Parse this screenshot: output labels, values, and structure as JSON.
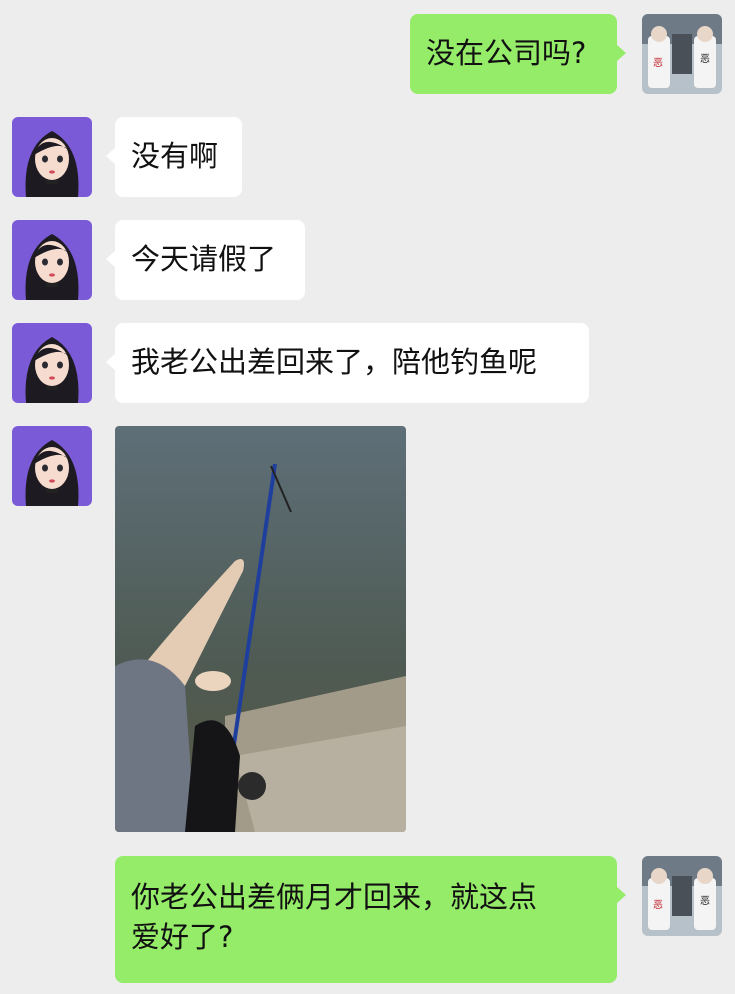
{
  "messages": [
    {
      "side": "out",
      "text": "没在公司吗?"
    },
    {
      "side": "in",
      "text": "没有啊"
    },
    {
      "side": "in",
      "text": "今天请假了"
    },
    {
      "side": "in",
      "text": "我老公出差回来了，陪他钓鱼呢"
    },
    {
      "side": "in",
      "type": "image",
      "icon": "fishing-photo"
    },
    {
      "side": "out",
      "text": "你老公出差俩月才回来，就这点\n爱好了?"
    }
  ],
  "colors": {
    "background": "#ededed",
    "outgoing_bubble": "#95ec69",
    "incoming_bubble": "#ffffff"
  }
}
